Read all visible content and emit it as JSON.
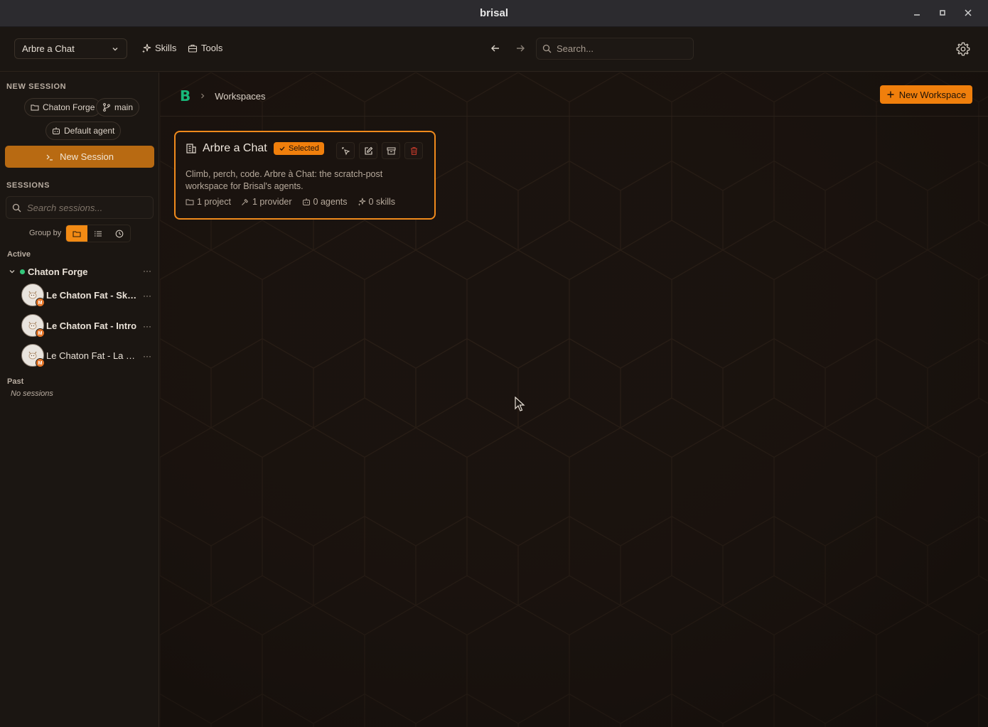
{
  "window": {
    "title": "brisal"
  },
  "toolbar": {
    "workspace_selected": "Arbre a Chat",
    "skills_label": "Skills",
    "tools_label": "Tools",
    "search_placeholder": "Search..."
  },
  "sidebar": {
    "new_session_title": "NEW SESSION",
    "project_chip": "Chaton Forge",
    "branch_chip": "main",
    "agent_chip": "Default agent",
    "new_session_button": "New Session",
    "sessions_title": "SESSIONS",
    "search_placeholder": "Search sessions...",
    "group_by_label": "Group by",
    "active_label": "Active",
    "group_name": "Chaton Forge",
    "sessions": [
      {
        "label": "Le Chaton Fat - Skill...",
        "bold": true
      },
      {
        "label": "Le Chaton Fat - Intro",
        "bold": true
      },
      {
        "label": "Le Chaton Fat - La Fo...",
        "bold": false
      }
    ],
    "avatar_badge": "M",
    "past_label": "Past",
    "no_sessions": "No sessions"
  },
  "main": {
    "logo_letter": "B",
    "breadcrumb": "Workspaces",
    "new_workspace_button": "New Workspace",
    "card": {
      "title": "Arbre a Chat",
      "badge": "Selected",
      "description": "Climb, perch, code. Arbre à Chat: the scratch-post workspace for Brisal's agents.",
      "projects": "1 project",
      "providers": "1 provider",
      "agents": "0 agents",
      "skills": "0 skills"
    }
  },
  "colors": {
    "accent": "#f07f0c",
    "active_dot": "#34c77b",
    "logo": "#19b87a",
    "delete": "#c0392b"
  }
}
